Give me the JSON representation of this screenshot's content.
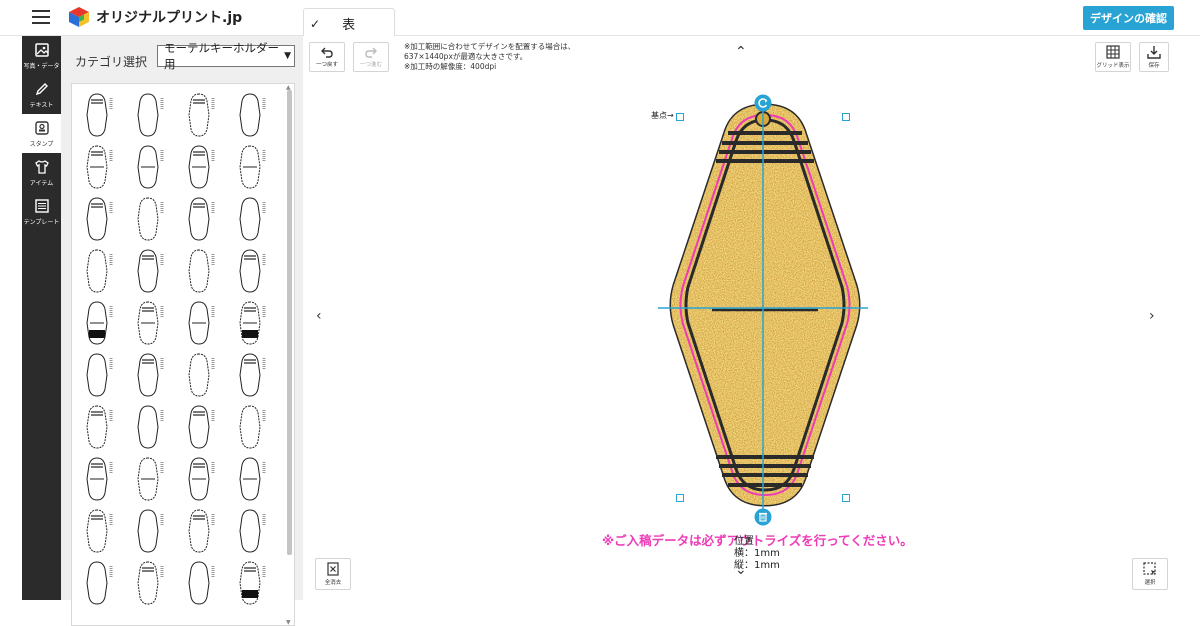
{
  "header": {
    "logo_text": "オリジナルプリント.jp",
    "tab_label": "表",
    "confirm_label": "デザインの確認"
  },
  "nav": {
    "items": [
      {
        "label": "写真・データ",
        "icon": "image-icon"
      },
      {
        "label": "テキスト",
        "icon": "pencil-icon"
      },
      {
        "label": "スタンプ",
        "icon": "stamp-icon"
      },
      {
        "label": "アイテム",
        "icon": "tshirt-icon"
      },
      {
        "label": "テンプレート",
        "icon": "list-icon"
      }
    ]
  },
  "panel": {
    "category_label": "カテゴリ選択",
    "category_value": "モーテルキーホルダー用"
  },
  "toolbar": {
    "undo_label": "一つ戻す",
    "redo_label": "一つ進む",
    "grid_label": "グリッド表示",
    "save_label": "保存",
    "clear_label": "全消去",
    "select_label": "選択"
  },
  "notes": {
    "line1": "※加工範囲に合わせてデザインを配置する場合は、",
    "line2": "637×1440pxが最適な大きさです。",
    "line3": "※加工時の解像度：400dpi"
  },
  "canvas": {
    "origin_label": "基点→",
    "warning": "※ご入稿データは必ずアウトライズを行ってください。",
    "position_title": "位置",
    "pos_x": "横：1mm",
    "pos_y": "縦：1mm"
  },
  "colors": {
    "accent": "#29a3d4",
    "warning": "#ee3bb6",
    "nav_bg": "#2b2b2b",
    "gold": "#d9a93a"
  }
}
